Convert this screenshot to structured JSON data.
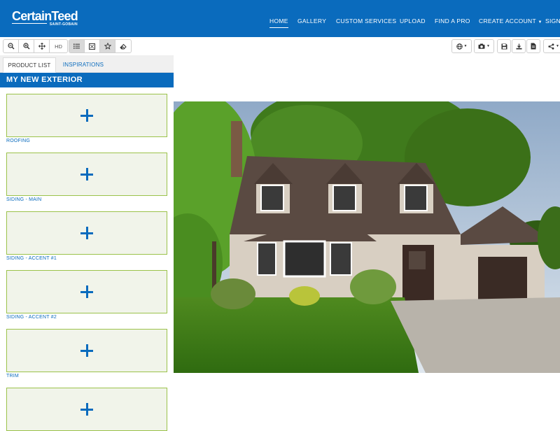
{
  "brand": {
    "name": "CertainTeed",
    "sub": "SAINT-GOBAIN"
  },
  "nav": {
    "home": "HOME",
    "gallery": "GALLERY",
    "custom_services": "CUSTOM SERVICES",
    "upload": "UPLOAD",
    "find_a_pro": "FIND A PRO",
    "create_account": "CREATE ACCOUNT",
    "sign_in": "SIGN"
  },
  "toolbar": {
    "hd_label": "HD",
    "icons": [
      "zoom-out-icon",
      "zoom-in-icon",
      "pan-icon",
      "hd",
      "list-icon",
      "compare-icon",
      "favorite-icon",
      "eraser-icon"
    ],
    "right_icons": [
      "globe-icon",
      "camera-icon",
      "save-icon",
      "download-icon",
      "document-icon",
      "share-icon"
    ]
  },
  "sidebar": {
    "tabs": {
      "product_list": "PRODUCT LIST",
      "inspirations": "INSPIRATIONS"
    },
    "title": "MY NEW EXTERIOR",
    "slots": [
      {
        "label": "ROOFING"
      },
      {
        "label": "SIDING - MAIN"
      },
      {
        "label": "SIDING - ACCENT #1"
      },
      {
        "label": "SIDING - ACCENT #2"
      },
      {
        "label": "TRIM"
      },
      {
        "label": ""
      }
    ]
  },
  "colors": {
    "brand_blue": "#0a6bbd",
    "slot_border": "#9bc24a",
    "slot_fill": "#f1f4ea"
  }
}
